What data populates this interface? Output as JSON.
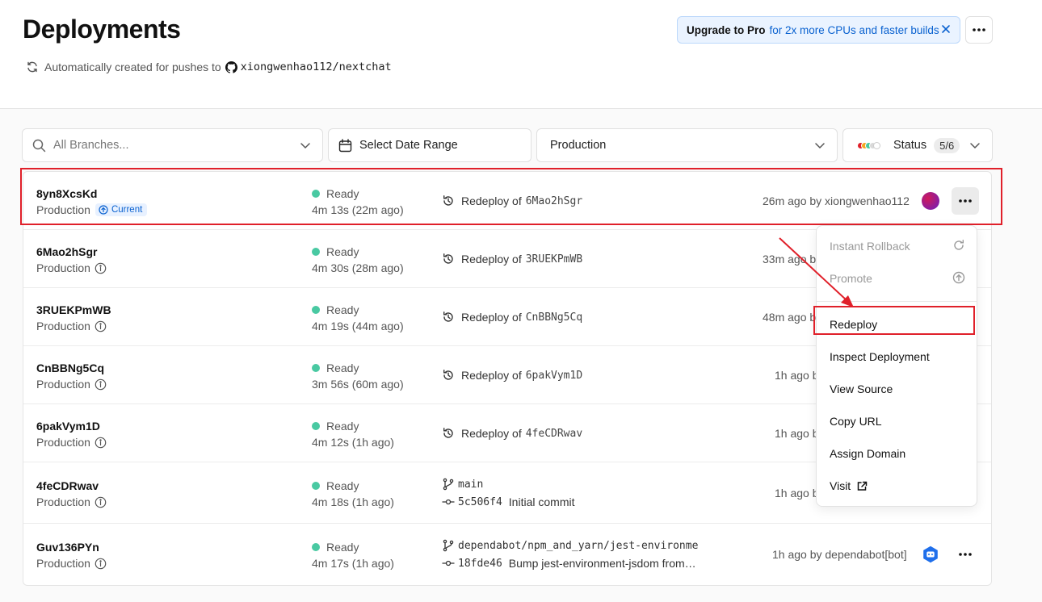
{
  "header": {
    "title": "Deployments",
    "subtitle": "Automatically created for pushes to",
    "repo": "xiongwenhao112/nextchat",
    "banner_strong": "Upgrade to Pro",
    "banner_text": "for 2x more CPUs and faster builds"
  },
  "filters": {
    "branch_placeholder": "All Branches...",
    "date_label": "Select Date Range",
    "environment_label": "Production",
    "status_label": "Status",
    "status_count": "5/6",
    "status_colors": [
      "#e0202a",
      "#f5a623",
      "#49c9a2",
      "#d9d9d9",
      "#ffffff"
    ]
  },
  "deployments": [
    {
      "id": "8yn8XcsKd",
      "env": "Production",
      "badge": "Current",
      "status": "Ready",
      "duration": "4m 13s (22m ago)",
      "source_prefix": "Redeploy of",
      "source_ref": "6Mao2hSgr",
      "time": "26m ago by xiongwenhao112"
    },
    {
      "id": "6Mao2hSgr",
      "env": "Production",
      "status": "Ready",
      "duration": "4m 30s (28m ago)",
      "source_prefix": "Redeploy of",
      "source_ref": "3RUEKPmWB",
      "time": "33m ago b"
    },
    {
      "id": "3RUEKPmWB",
      "env": "Production",
      "status": "Ready",
      "duration": "4m 19s (44m ago)",
      "source_prefix": "Redeploy of",
      "source_ref": "CnBBNg5Cq",
      "time": "48m ago b"
    },
    {
      "id": "CnBBNg5Cq",
      "env": "Production",
      "status": "Ready",
      "duration": "3m 56s (60m ago)",
      "source_prefix": "Redeploy of",
      "source_ref": "6pakVym1D",
      "time": "1h ago b"
    },
    {
      "id": "6pakVym1D",
      "env": "Production",
      "status": "Ready",
      "duration": "4m 12s (1h ago)",
      "source_prefix": "Redeploy of",
      "source_ref": "4feCDRwav",
      "time": "1h ago b"
    },
    {
      "id": "4feCDRwav",
      "env": "Production",
      "status": "Ready",
      "duration": "4m 18s (1h ago)",
      "branch": "main",
      "commit": "5c506f4",
      "commit_msg": "Initial commit",
      "time": "1h ago b"
    },
    {
      "id": "Guv136PYn",
      "env": "Production",
      "status": "Ready",
      "duration": "4m 17s (1h ago)",
      "branch": "dependabot/npm_and_yarn/jest-environme",
      "commit": "18fde46",
      "commit_msg": "Bump jest-environment-jsdom from…",
      "time": "1h ago by dependabot[bot]"
    }
  ],
  "menu": {
    "items": [
      "Instant Rollback",
      "Promote",
      "Redeploy",
      "Inspect Deployment",
      "View Source",
      "Copy URL",
      "Assign Domain",
      "Visit"
    ]
  },
  "colors": {
    "ready": "#49c9a2",
    "highlight": "#e0202a",
    "link": "#0a62d0"
  }
}
